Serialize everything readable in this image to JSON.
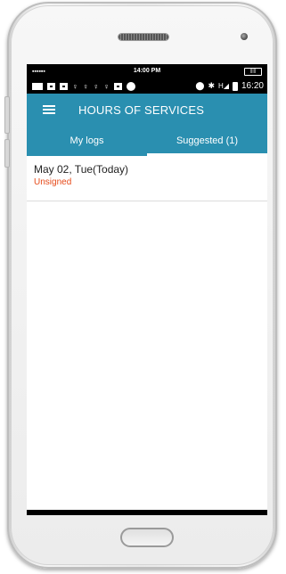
{
  "sim": {
    "dots": "▪▪▪▪▪▪",
    "time": "14:00 PM",
    "battery": "|||||"
  },
  "status": {
    "clock": "16:20",
    "signal_label": "H"
  },
  "app": {
    "title": "HOURS OF SERVICES"
  },
  "tabs": [
    {
      "label": "My logs",
      "active": false
    },
    {
      "label": "Suggested (1)",
      "active": true
    }
  ],
  "logs": [
    {
      "date": "May 02, Tue(Today)",
      "status": "Unsigned"
    }
  ],
  "colors": {
    "primary": "#2a8fb0",
    "unsigned": "#e64a19"
  }
}
